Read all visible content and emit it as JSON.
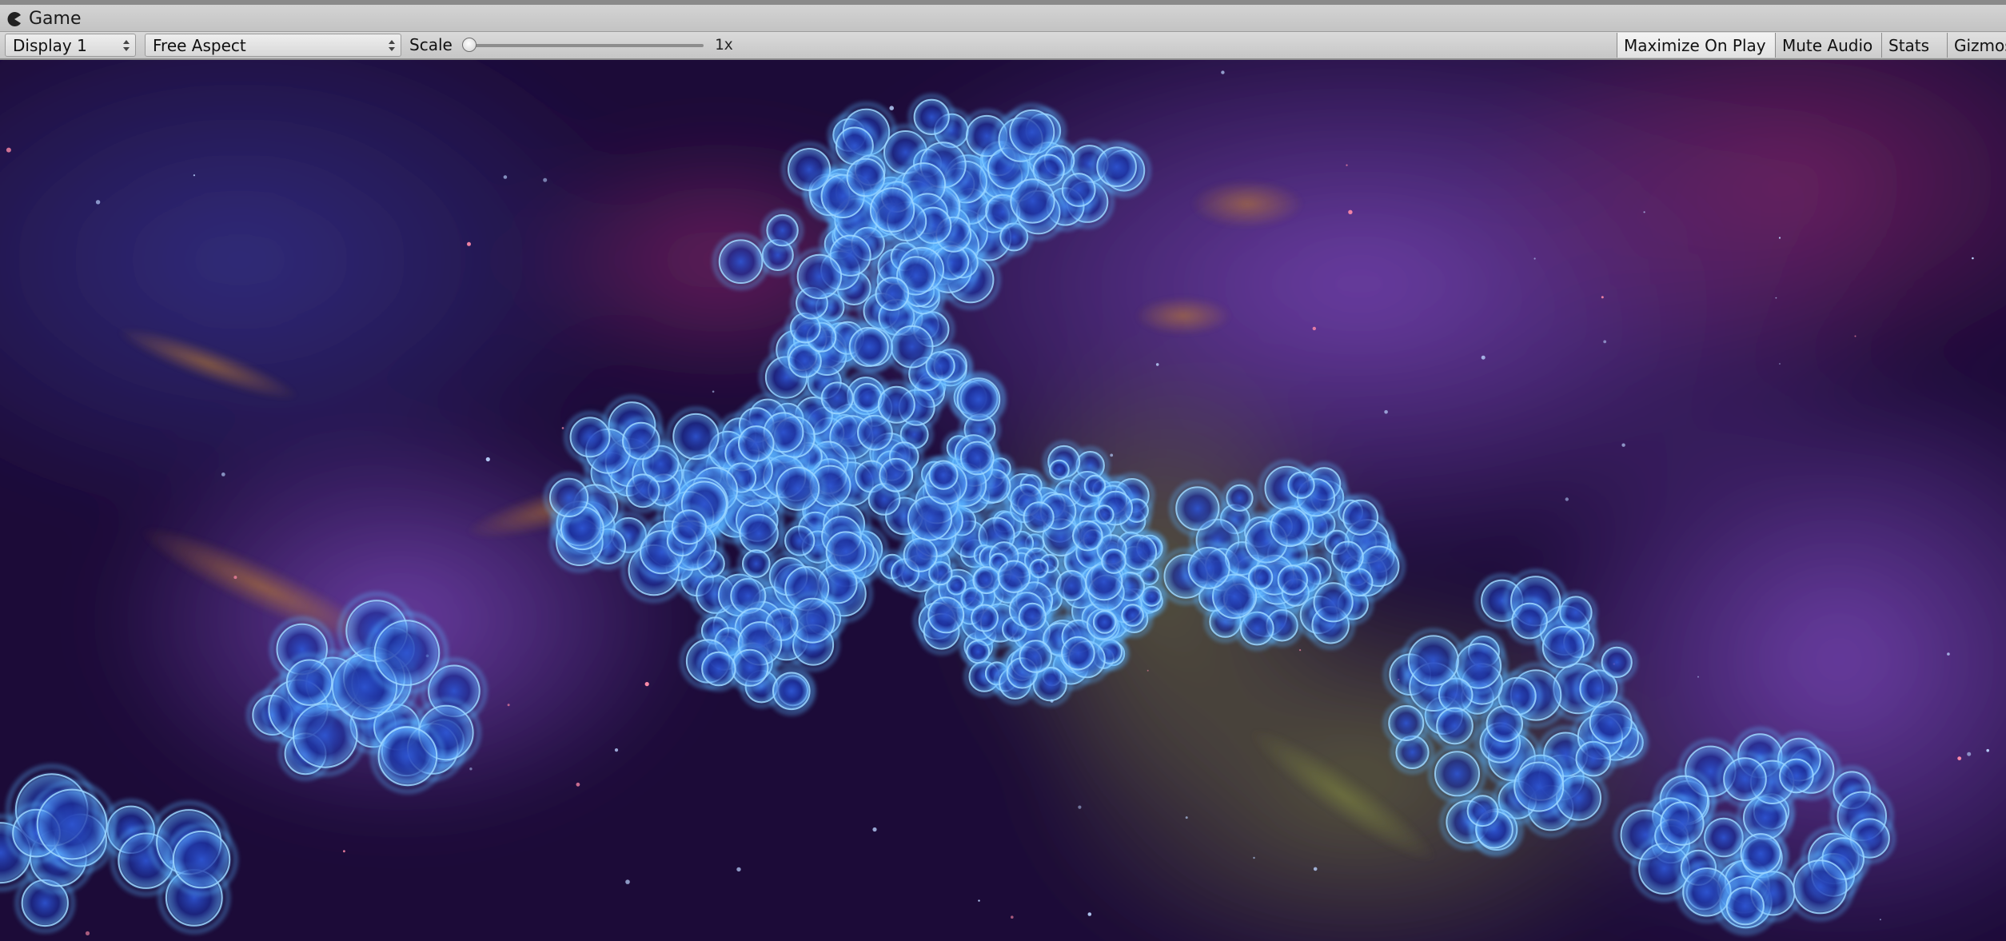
{
  "window": {
    "tab_label": "Game",
    "tab_icon": "pacman-icon"
  },
  "toolbar": {
    "display": {
      "selected": "Display 1",
      "icon": "dropdown-arrows-icon"
    },
    "aspect": {
      "selected": "Free Aspect",
      "icon": "dropdown-arrows-icon"
    },
    "scale": {
      "label": "Scale",
      "value": 1,
      "value_text": "1x"
    },
    "buttons": {
      "maximize_on_play": "Maximize On Play",
      "mute_audio": "Mute Audio",
      "stats": "Stats",
      "gizmos": "Gizmos"
    }
  },
  "viewport": {
    "description_kind": "game-render",
    "colors": {
      "space_dark": "#14082a",
      "nebula_purple": "#5a2a8c",
      "nebula_magenta": "#6a1f5a",
      "dust_orange": "#b8782a",
      "gas_green": "#4f5a2a",
      "bubble_glow": "#6ab8ff",
      "bubble_core": "#2a52c8"
    }
  }
}
